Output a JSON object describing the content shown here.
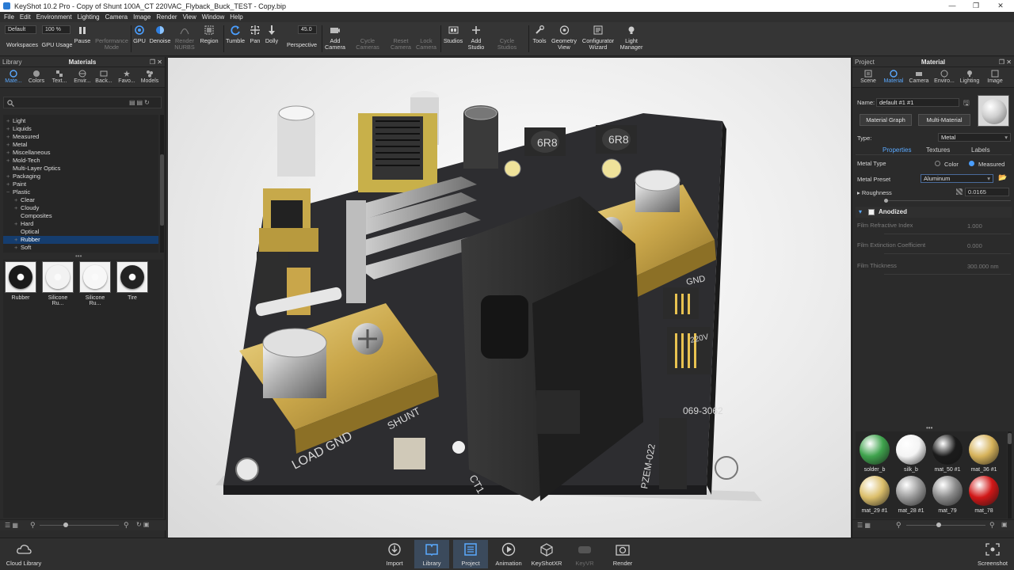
{
  "window": {
    "title": "KeyShot 10.2 Pro  -  Copy of Shunt 100A_CT 220VAC_Flyback_Buck_TEST - Copy.bip",
    "controls": [
      "—",
      "❐",
      "✕"
    ]
  },
  "menu": [
    "File",
    "Edit",
    "Environment",
    "Lighting",
    "Camera",
    "Image",
    "Render",
    "View",
    "Window",
    "Help"
  ],
  "toolbar": {
    "workspace_value": "Default",
    "workspace_label": "Workspaces",
    "cpu_value": "100 %",
    "cpu_label": "GPU Usage",
    "pause": "Pause",
    "performance": "Performance\nMode",
    "gpu": "GPU",
    "denoise": "Denoise",
    "render_nurbs": "Render\nNURBS",
    "region": "Region",
    "tumble": "Tumble",
    "pan": "Pan",
    "dolly": "Dolly",
    "fov_value": "45.0",
    "perspective": "Perspective",
    "add_camera": "Add\nCamera",
    "cycle_cameras": "Cycle\nCameras",
    "reset_camera": "Reset\nCamera",
    "lock_camera": "Lock\nCamera",
    "studios": "Studios",
    "add_studio": "Add\nStudio",
    "cycle_studios": "Cycle\nStudios",
    "tools": "Tools",
    "geometry_view": "Geometry\nView",
    "configurator_wizard": "Configurator\nWizard",
    "light_manager": "Light\nManager"
  },
  "library": {
    "panel_label": "Library",
    "title": "Materials",
    "tabs": [
      "Mate...",
      "Colors",
      "Text...",
      "Envir...",
      "Back...",
      "Favo...",
      "Models"
    ],
    "tree": [
      {
        "label": "Light",
        "level": 0,
        "expander": "+"
      },
      {
        "label": "Liquids",
        "level": 0,
        "expander": "+"
      },
      {
        "label": "Measured",
        "level": 0,
        "expander": "+"
      },
      {
        "label": "Metal",
        "level": 0,
        "expander": "+"
      },
      {
        "label": "Miscellaneous",
        "level": 0,
        "expander": "+"
      },
      {
        "label": "Mold-Tech",
        "level": 0,
        "expander": "+"
      },
      {
        "label": "Multi-Layer Optics",
        "level": 0,
        "expander": ""
      },
      {
        "label": "Packaging",
        "level": 0,
        "expander": "+"
      },
      {
        "label": "Paint",
        "level": 0,
        "expander": "+"
      },
      {
        "label": "Plastic",
        "level": 0,
        "expander": "−"
      },
      {
        "label": "Clear",
        "level": 1,
        "expander": "+"
      },
      {
        "label": "Cloudy",
        "level": 1,
        "expander": "+"
      },
      {
        "label": "Composites",
        "level": 1,
        "expander": ""
      },
      {
        "label": "Hard",
        "level": 1,
        "expander": "+"
      },
      {
        "label": "Optical",
        "level": 1,
        "expander": ""
      },
      {
        "label": "Rubber",
        "level": 1,
        "expander": "+",
        "selected": true
      },
      {
        "label": "Soft",
        "level": 1,
        "expander": "+"
      }
    ],
    "thumbnails": [
      {
        "label": "Rubber",
        "color": "#1a1a1a"
      },
      {
        "label": "Silicone Ru...",
        "color": "#f2f2f2"
      },
      {
        "label": "Silicone Ru...",
        "color": "#f7f7f7"
      },
      {
        "label": "Tire",
        "color": "#222222"
      }
    ]
  },
  "project": {
    "panel_label": "Project",
    "title": "Material",
    "tabs": [
      "Scene",
      "Material",
      "Camera",
      "Enviro...",
      "Lighting",
      "Image"
    ],
    "name_label": "Name:",
    "name_value": "default #1 #1",
    "material_graph": "Material Graph",
    "multi_material": "Multi-Material",
    "type_label": "Type:",
    "type_value": "Metal",
    "subtabs": [
      "Properties",
      "Textures",
      "Labels"
    ],
    "metal_type_label": "Metal Type",
    "metal_type_options": [
      "Color",
      "Measured"
    ],
    "metal_type_selected": "Measured",
    "metal_preset_label": "Metal Preset",
    "metal_preset_value": "Aluminum",
    "roughness_label": "Roughness",
    "roughness_value": "0.0165",
    "anodized_label": "Anodized",
    "film_refr_label": "Film Refractive Index",
    "film_refr_value": "1.000",
    "film_ext_label": "Film Extinction Coefficient",
    "film_ext_value": "0.000",
    "film_thick_label": "Film Thickness",
    "film_thick_value": "300.000 nm",
    "materials": [
      {
        "label": "solder_b",
        "color": "#3fa34d"
      },
      {
        "label": "silk_b",
        "color": "#f4f4f4"
      },
      {
        "label": "mat_50 #1",
        "color": "#1b1b1b"
      },
      {
        "label": "mat_36 #1",
        "color": "#d6b25a"
      },
      {
        "label": "mat_29 #1",
        "color": "#dcbf6b"
      },
      {
        "label": "mat_28 #1",
        "color": "#9a9a9a"
      },
      {
        "label": "mat_79",
        "color": "#8a8a8a"
      },
      {
        "label": "mat_78",
        "color": "#d11717"
      }
    ]
  },
  "bottombar": {
    "cloud_library": "Cloud Library",
    "import": "Import",
    "library": "Library",
    "project": "Project",
    "animation": "Animation",
    "keyshotxr": "KeyShotXR",
    "keyvr": "KeyVR",
    "render": "Render",
    "screenshot": "Screenshot"
  },
  "scene": {
    "pcb_labels": [
      "LOAD GND",
      "SHUNT",
      "CT1",
      "PZEM-022",
      "6R8",
      "6R8",
      "069-3062",
      "GND",
      "220V"
    ]
  },
  "colors": {
    "accent": "#4a9eff",
    "selection": "#153d6e",
    "pcb": "#2d2d30",
    "brass": "#c9a64a"
  }
}
